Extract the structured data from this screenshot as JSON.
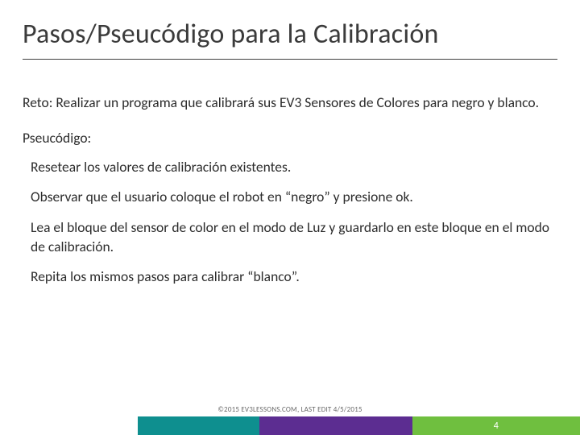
{
  "title": "Pasos/Pseucódigo para la Calibración",
  "reto": "Reto: Realizar un programa que calibrará sus EV3 Sensores de Colores para negro y blanco.",
  "pc_label": "Pseucódigo:",
  "steps": [
    "Resetear los valores de calibración existentes.",
    "Observar que el usuario coloque el robot en “negro” y presione ok.",
    "Lea el bloque del sensor de color en el modo de Luz y guardarlo en este bloque en el modo de calibración.",
    "Repita  los mismos pasos para calibrar “blanco”."
  ],
  "copyright": "©2015 EV3LESSONS.COM, LAST EDIT 4/5/2015",
  "page_number": "4"
}
